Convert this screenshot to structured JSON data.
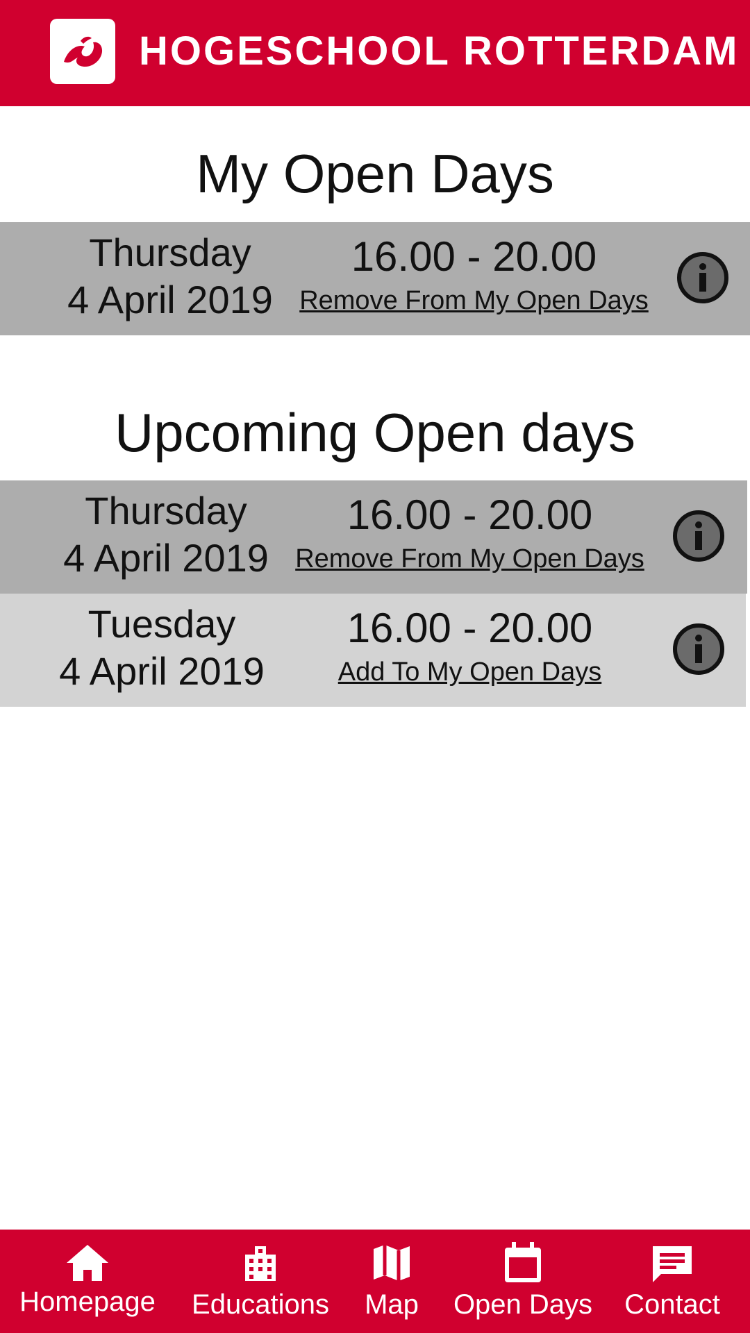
{
  "header": {
    "brand": "HOGESCHOOL ROTTERDAM",
    "logo_icon": "hr-logo",
    "background": "#d0002f"
  },
  "my_open_days": {
    "title": "My Open Days",
    "items": [
      {
        "day": "Thursday",
        "date": "4 April 2019",
        "time": "16.00 - 20.00",
        "action": "Remove From My Open Days",
        "icon": "info-icon"
      }
    ]
  },
  "upcoming_open_days": {
    "title": "Upcoming Open days",
    "items": [
      {
        "day": "Thursday",
        "date": "4 April 2019",
        "time": "16.00 - 20.00",
        "action": "Remove From My Open Days",
        "icon": "info-icon"
      },
      {
        "day": "Tuesday",
        "date": "4 April 2019",
        "time": "16.00 - 20.00",
        "action": "Add To My Open Days",
        "icon": "info-icon"
      }
    ]
  },
  "bottom_nav": {
    "items": [
      {
        "label": "Homepage",
        "icon": "home-icon"
      },
      {
        "label": "Educations",
        "icon": "building-icon"
      },
      {
        "label": "Map",
        "icon": "map-icon"
      },
      {
        "label": "Open Days",
        "icon": "calendar-icon"
      },
      {
        "label": "Contact",
        "icon": "chat-icon"
      }
    ]
  },
  "colors": {
    "brand_red": "#d0002f",
    "row_selected": "#adadad",
    "row_default": "#d3d3d3",
    "info_fill": "#6b6b6b"
  }
}
